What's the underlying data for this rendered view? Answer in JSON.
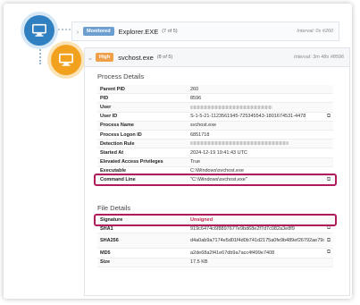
{
  "parent_process": {
    "badge": "Monitored",
    "name": "Explorer.EXE",
    "count": "(7 of 5)",
    "interval": "Interval: 0s #260"
  },
  "child_process": {
    "badge": "High",
    "name": "svchost.exe",
    "count": "(8 of 5)",
    "interval": "Interval: 3m 48s #8596"
  },
  "process_details": {
    "title": "Process Details",
    "rows": [
      {
        "key": "Parent PID",
        "value": "260"
      },
      {
        "key": "PID",
        "value": "8596"
      },
      {
        "key": "User",
        "value": ""
      },
      {
        "key": "User ID",
        "value": "S-1-5-21-1123561945-725345543-1801674531-4478"
      },
      {
        "key": "Process Name",
        "value": "svchost.exe"
      },
      {
        "key": "Process Logon ID",
        "value": "6851718"
      },
      {
        "key": "Detection Rule",
        "value": ""
      },
      {
        "key": "Started At",
        "value": "2024-12-19 19:41:43 UTC"
      },
      {
        "key": "Elevated Access Privileges",
        "value": "True"
      },
      {
        "key": "Executable",
        "value": "C:\\Windows\\svchost.exe"
      },
      {
        "key": "Command Line",
        "value": "\"C:\\Windows\\svchost.exe\""
      }
    ]
  },
  "file_details": {
    "title": "File Details",
    "rows": [
      {
        "key": "Signature",
        "value": "Unsigned"
      },
      {
        "key": "SHA1",
        "value": "919c6474c6f8897677e9bd68e2f7d7c082a3e8f9"
      },
      {
        "key": "SHA256",
        "value": "d4a0ab9a7174e5d01f4d0b741d2175a0fe9b489ef26792ae79c80fded9e49740"
      },
      {
        "key": "MD5",
        "value": "a2de68a2f41e67db9a7acc4f499e7408"
      },
      {
        "key": "Size",
        "value": "17.5 KB"
      }
    ]
  },
  "icons": {
    "computer": "computer-icon",
    "copy": "copy-icon",
    "chevron": "chevron-icon"
  },
  "colors": {
    "blue_node": "#2f7fc1",
    "orange_node": "#f2a11f",
    "highlight": "#b01c5b",
    "unsigned": "#c7254e"
  }
}
